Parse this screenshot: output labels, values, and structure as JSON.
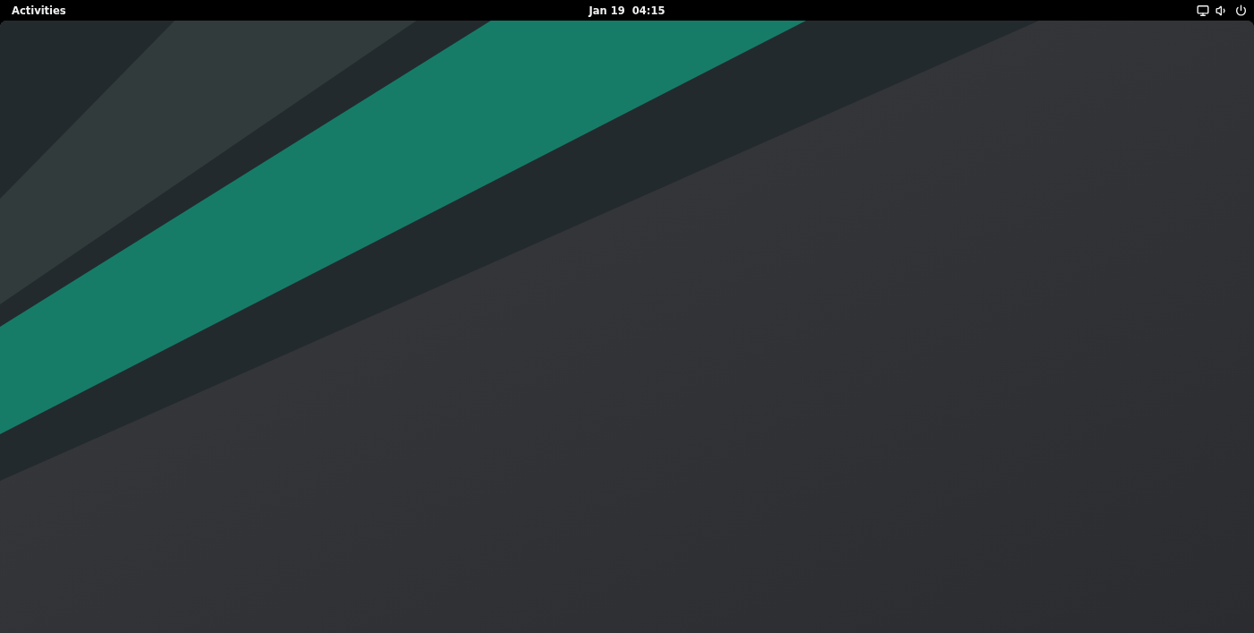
{
  "top_bar": {
    "activities": "Activities",
    "clock": "Jan 19  04:15"
  }
}
